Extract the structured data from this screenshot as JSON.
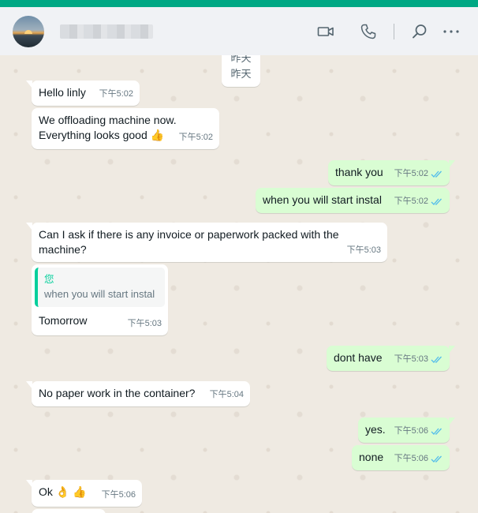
{
  "header": {
    "contact_name": "",
    "video_call_icon": "video-camera-icon",
    "voice_call_icon": "phone-icon",
    "search_icon": "search-icon",
    "menu_icon": "more-icon"
  },
  "colors": {
    "accent": "#00a884",
    "incoming_bubble": "#ffffff",
    "outgoing_bubble": "#d9fdd3",
    "read_ticks": "#53bdeb",
    "quote_bar": "#06cf9c"
  },
  "date_divider": {
    "line1": "昨天",
    "line2": "昨天"
  },
  "messages": [
    {
      "direction": "in",
      "text": "Hello linly",
      "time": "下午5:02"
    },
    {
      "direction": "in",
      "text_line1": "We offloading machine now.",
      "text_line2": "Everything looks good 👍",
      "time": "下午5:02"
    },
    {
      "direction": "out",
      "text": "thank you",
      "time": "下午5:02",
      "status": "read"
    },
    {
      "direction": "out",
      "text": "when you will start instal",
      "time": "下午5:02",
      "status": "read"
    },
    {
      "direction": "in",
      "text_line1": "Can I ask if there is any invoice or paperwork packed with the",
      "text_line2": "machine?",
      "time": "下午5:03"
    },
    {
      "direction": "in",
      "quote_author": "您",
      "quote_text": "when you will start instal",
      "text": "Tomorrow",
      "time": "下午5:03"
    },
    {
      "direction": "out",
      "text": "dont have",
      "time": "下午5:03",
      "status": "read"
    },
    {
      "direction": "in",
      "text": "No paper work in the container?",
      "time": "下午5:04"
    },
    {
      "direction": "out",
      "text": "yes.",
      "time": "下午5:06",
      "status": "read"
    },
    {
      "direction": "out",
      "text": "none",
      "time": "下午5:06",
      "status": "read"
    },
    {
      "direction": "in",
      "text": "Ok 👌 👍",
      "time": "下午5:06"
    }
  ]
}
